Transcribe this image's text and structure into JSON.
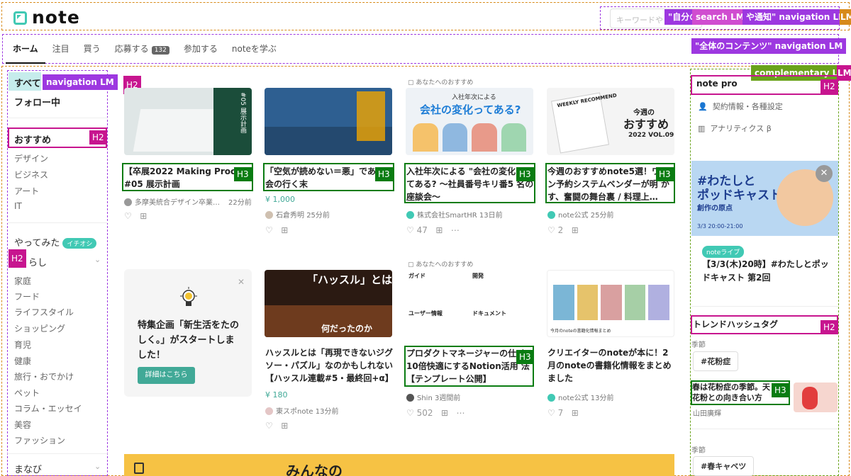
{
  "header": {
    "logo_text": "note",
    "search_placeholder": "キーワードや",
    "landmarks": {
      "top_right": "\"自分の",
      "search": "search LM",
      "nav_notify": "や通知\" navigation LM",
      "orange": "LM"
    }
  },
  "tabs": [
    {
      "label": "ホーム"
    },
    {
      "label": "注目"
    },
    {
      "label": "買う"
    },
    {
      "label": "応募する",
      "count": "132"
    },
    {
      "label": "参加する"
    },
    {
      "label": "noteを学ぶ"
    }
  ],
  "landmarks": {
    "global_nav": "\"全体のコンテンツ\" navigation LM",
    "side_nav": "navigation LM",
    "complementary": "complementary LM",
    "comp_suffix": "LM",
    "h2": "H2",
    "h3": "H3"
  },
  "sidebar": {
    "all": "すべて",
    "following": "フォロー中",
    "recommended": "おすすめ",
    "rec_items": [
      "デザイン",
      "ビジネス",
      "アート",
      "IT"
    ],
    "trying": "やってみた",
    "trying_badge": "イチオシ",
    "life": "らし",
    "life_items": [
      "家庭",
      "フード",
      "ライフスタイル",
      "ショッピング",
      "育児",
      "健康",
      "旅行・おでかけ",
      "ペット",
      "コラム・エッセイ",
      "美容",
      "ファッション"
    ],
    "learn": "まなび"
  },
  "cards_row1": [
    {
      "title": "【卒展2022 Making Proce #05 展示計画",
      "author": "多摩美統合デザイン卒業…",
      "time": "22分前",
      "likes": "",
      "rec": ""
    },
    {
      "title": "「空気が読めない＝悪」である 会の行く末",
      "price": "¥ 1,000",
      "author": "石倉秀明",
      "time": "25分前",
      "likes": "",
      "rec": ""
    },
    {
      "title": "入社年次による \"会社の変化 ってある? 〜社員番号キリ番5 名の座談会〜",
      "author": "株式会社SmartHR",
      "time": "13日前",
      "likes": "47",
      "rec": "あなたへのおすすめ"
    },
    {
      "title": "今週のおすすめnote5選！ワ チン予約システムベンダーが明 かす、奮闘の舞台裏 / 料理上…",
      "author": "note公式",
      "time": "25分前",
      "likes": "2",
      "rec": ""
    }
  ],
  "cards_row2": [
    {
      "title": "特集企画「新生活をたのしく。」がスタートしました！",
      "button": "詳細はこちら"
    },
    {
      "title": "ハッスルとは「再現できないジグソー・パズル」なのかもしれない【ハッスル連載#5・最終回+α】",
      "price": "¥ 180",
      "author": "東スポnote",
      "time": "13分前"
    },
    {
      "title": "プロダクトマネージャーの仕 を10倍快適にするNotion活用 法【テンプレート公開】",
      "author": "Shin",
      "time": "3週間前",
      "likes": "502",
      "rec": "あなたへのおすすめ"
    },
    {
      "title": "クリエイターのnoteが本に！2月のnoteの書籍化情報をまとめました",
      "author": "note公式",
      "time": "13分前",
      "likes": "7"
    }
  ],
  "card_images": {
    "img1_text": "#05 展示計画",
    "img2_text": "",
    "img3_line1": "入社年次による",
    "img3_line2": "会社の変化ってある?",
    "img4_line1": "WEEKLY RECOMMEND",
    "img4_line2": "今週の",
    "img4_line3": "おすすめ",
    "img4_line4": "2022 VOL.09",
    "img6_text": "「ハッスル」とは",
    "img6_sub": "何だったのか",
    "img7_a": "ガイド",
    "img7_b": "開発",
    "img7_c": "ユーザー情報",
    "img7_d": "ドキュメント",
    "img8_caption": "今月のnoteの書籍化情報まとめ",
    "banner_text": "みんなの"
  },
  "right": {
    "note_pro": "note pro",
    "contract": "契約情報・各種設定",
    "analytics": "アナリティクス β",
    "ad_line1": "#わたしと",
    "ad_line2": "ポッドキャスト",
    "ad_line3": "創作の原点",
    "ad_line4": "3/3 20:00-21:00",
    "ad_badge": "noteライブ",
    "ad_title": "【3/3(木)20時】#わたしとポッドキャスト 第2回",
    "trend_title": "トレンドハッシュタグ",
    "season1": "季節",
    "tag1": "#花粉症",
    "article": "春は花粉症の季節。天 スギ花粉との向き合い方",
    "article_author": "山田廣輝",
    "season2": "季節",
    "tag2": "#春キャベツ"
  },
  "colors": {
    "accent": "#41c9b4",
    "h2": "#c7158f",
    "h3": "#0a7c12",
    "nav_lm": "#9d38e0"
  }
}
